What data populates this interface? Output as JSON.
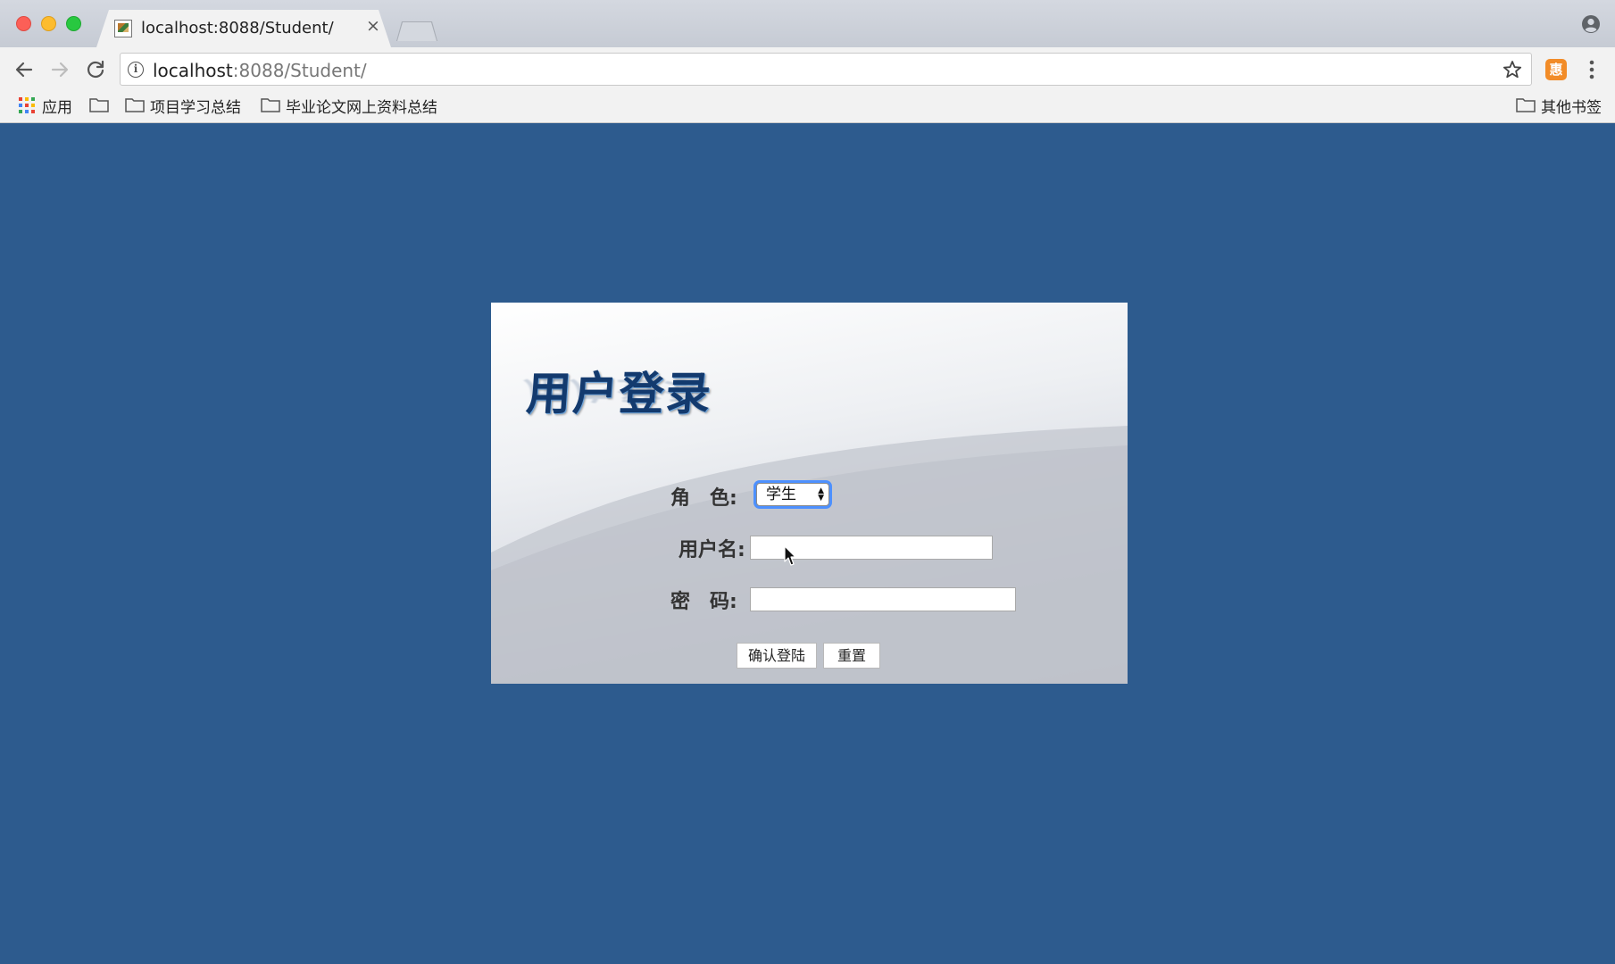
{
  "browser": {
    "tab_title": "localhost:8088/Student/",
    "tab_close": "×",
    "url_host": "localhost",
    "url_rest": ":8088/Student/",
    "extension_label": "惠"
  },
  "bookmarks": {
    "apps_label": "应用",
    "items": [
      {
        "label": "项目学习总结"
      },
      {
        "label": "毕业论文网上资料总结"
      }
    ],
    "other_label": "其他书签"
  },
  "login": {
    "title": "用户登录",
    "role_label": "角　色:",
    "role_value": "学生",
    "username_label": "用户名:",
    "username_value": "",
    "password_label": "密　码:",
    "password_value": "",
    "submit_label": "确认登陆",
    "reset_label": "重置"
  },
  "colors": {
    "page_background": "#2d5b8e",
    "title_color": "#133a6e",
    "focus_ring": "#4d90fe"
  }
}
